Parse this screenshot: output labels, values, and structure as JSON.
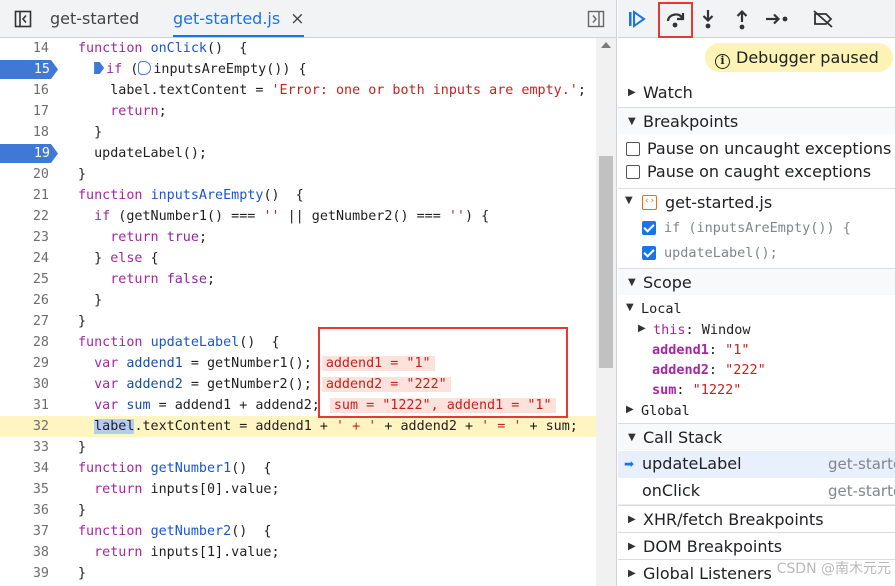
{
  "tabs": {
    "file1": "get-started",
    "file2": "get-started.js",
    "close": "×"
  },
  "code": [
    {
      "n": "14",
      "bp": false,
      "html": "<span class='kw'>function</span> <span class='fn'>onClick</span>()  {"
    },
    {
      "n": "15",
      "bp": true,
      "html": "  <span class='bpmark'></span><span class='kw'>if</span> (<span class='bpmark2'></span>inputsAreEmpty()) {"
    },
    {
      "n": "16",
      "bp": false,
      "html": "    label.textContent = <span class='str'>'Error: one or both inputs are empty.'</span>;"
    },
    {
      "n": "17",
      "bp": false,
      "html": "    <span class='kw'>return</span>;"
    },
    {
      "n": "18",
      "bp": false,
      "html": "  }"
    },
    {
      "n": "19",
      "bp": true,
      "html": "  updateLabel();"
    },
    {
      "n": "20",
      "bp": false,
      "html": "}"
    },
    {
      "n": "21",
      "bp": false,
      "html": "<span class='kw'>function</span> <span class='fn'>inputsAreEmpty</span>()  {"
    },
    {
      "n": "22",
      "bp": false,
      "html": "  <span class='kw'>if</span> (getNumber1() === <span class='str'>''</span> || getNumber2() === <span class='str'>''</span>) {"
    },
    {
      "n": "23",
      "bp": false,
      "html": "    <span class='kw'>return</span> <span class='kw2'>true</span>;"
    },
    {
      "n": "24",
      "bp": false,
      "html": "  } <span class='kw'>else</span> {"
    },
    {
      "n": "25",
      "bp": false,
      "html": "    <span class='kw'>return</span> <span class='kw2'>false</span>;"
    },
    {
      "n": "26",
      "bp": false,
      "html": "  }"
    },
    {
      "n": "27",
      "bp": false,
      "html": "}"
    },
    {
      "n": "28",
      "bp": false,
      "html": "<span class='kw'>function</span> <span class='fn'>updateLabel</span>()  {"
    },
    {
      "n": "29",
      "bp": false,
      "html": "  <span class='kw'>var</span> <span class='var'>addend1</span> = getNumber1();<span class='inl'>addend1 = \"1\"</span>"
    },
    {
      "n": "30",
      "bp": false,
      "html": "  <span class='kw'>var</span> <span class='var'>addend2</span> = getNumber2();<span class='inl'>addend2 = \"222\"</span>"
    },
    {
      "n": "31",
      "bp": false,
      "html": "  <span class='kw'>var</span> <span class='var'>sum</span> = addend1 + addend2;<span class='inl'>sum = \"1222\", addend1 = \"1\"</span>"
    },
    {
      "n": "32",
      "bp": false,
      "current": true,
      "html": "  <span class='sel'>label</span>.textContent = addend1 + <span class='str'>' + '</span> + addend2 + <span class='str'>' = '</span> + sum;"
    },
    {
      "n": "33",
      "bp": false,
      "html": "}"
    },
    {
      "n": "34",
      "bp": false,
      "html": "<span class='kw'>function</span> <span class='fn'>getNumber1</span>()  {"
    },
    {
      "n": "35",
      "bp": false,
      "html": "  <span class='kw'>return</span> inputs[0].value;"
    },
    {
      "n": "36",
      "bp": false,
      "html": "}"
    },
    {
      "n": "37",
      "bp": false,
      "html": "<span class='kw'>function</span> <span class='fn'>getNumber2</span>()  {"
    },
    {
      "n": "38",
      "bp": false,
      "html": "  <span class='kw'>return</span> inputs[1].value;"
    },
    {
      "n": "39",
      "bp": false,
      "html": "}"
    }
  ],
  "debugger": {
    "paused_label": "Debugger paused",
    "watch": "Watch",
    "breakpoints": "Breakpoints",
    "pause_uncaught": "Pause on uncaught exceptions",
    "pause_caught": "Pause on caught exceptions",
    "bp_file": "get-started.js",
    "bp_line1": "if (inputsAreEmpty()) {",
    "bp_line2": "updateLabel();",
    "scope": "Scope",
    "local": "Local",
    "this_key": "this",
    "this_val": "Window",
    "addend1_key": "addend1",
    "addend1_val": "\"1\"",
    "addend2_key": "addend2",
    "addend2_val": "\"222\"",
    "sum_key": "sum",
    "sum_val": "\"1222\"",
    "global": "Global",
    "call_stack": "Call Stack",
    "frame1": "updateLabel",
    "frame1_src": "get-starte",
    "frame2": "onClick",
    "frame2_src": "get-starte",
    "xhr": "XHR/fetch Breakpoints",
    "dom": "DOM Breakpoints",
    "global_listeners": "Global Listeners",
    "watermark": "CSDN @南木元元"
  },
  "colors": {
    "accent": "#1a73e8",
    "breakpoint": "#3f78d6",
    "highlight_box": "#e53935",
    "paused_bg": "#fdf3b5",
    "current_line": "#fff5c2"
  }
}
